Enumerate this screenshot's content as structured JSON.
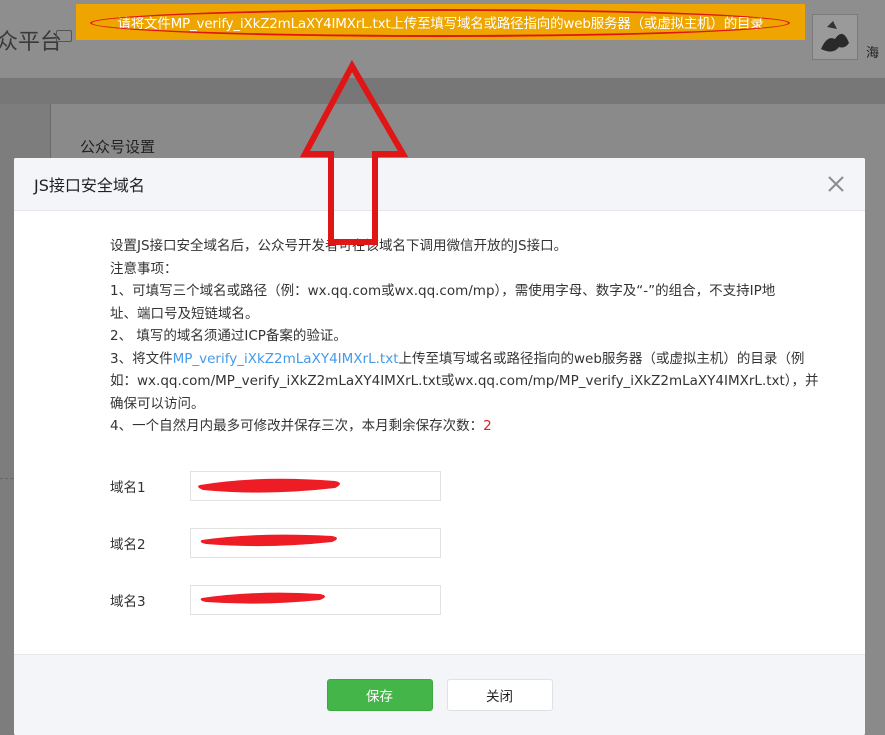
{
  "background": {
    "platform_title": "众平台",
    "user_name": "海",
    "section_title": "公众号设置"
  },
  "notice": {
    "text": "请将文件MP_verify_iXkZ2mLaXY4IMXrL.txt上传至填写域名或路径指向的web服务器（或虚拟主机）的目录"
  },
  "modal": {
    "title": "JS接口安全域名",
    "close_icon": "close-icon",
    "intro": "设置JS接口安全域名后，公众号开发者可在该域名下调用微信开放的JS接口。",
    "notes_heading": "注意事项：",
    "note1_line1": "1、可填写三个域名或路径（例：wx.qq.com或wx.qq.com/mp），需使用字母、数字及“-”的组合，不支持IP地",
    "note1_line2": "址、端口号及短链域名。",
    "note2": "2、 填写的域名须通过ICP备案的验证。",
    "note3_prefix": "3、将文件",
    "note3_link": "MP_verify_iXkZ2mLaXY4IMXrL.txt",
    "note3_suffix": "上传至填写域名或路径指向的web服务器（或虚拟主机）的目录（例",
    "note3_line2": "如：wx.qq.com/MP_verify_iXkZ2mLaXY4IMXrL.txt或wx.qq.com/mp/MP_verify_iXkZ2mLaXY4IMXrL.txt），并",
    "note3_line3": "确保可以访问。",
    "note4_prefix": "4、一个自然月内最多可修改并保存三次，本月剩余保存次数：",
    "note4_count": "2",
    "fields": [
      {
        "label": "域名1",
        "value": ""
      },
      {
        "label": "域名2",
        "value": ""
      },
      {
        "label": "域名3",
        "value": ""
      }
    ],
    "save_label": "保存",
    "close_label": "关闭"
  },
  "colors": {
    "notice_bg": "#eea500",
    "annotation_red": "#e01515",
    "link": "#459ae9",
    "primary_button": "#44b549"
  }
}
